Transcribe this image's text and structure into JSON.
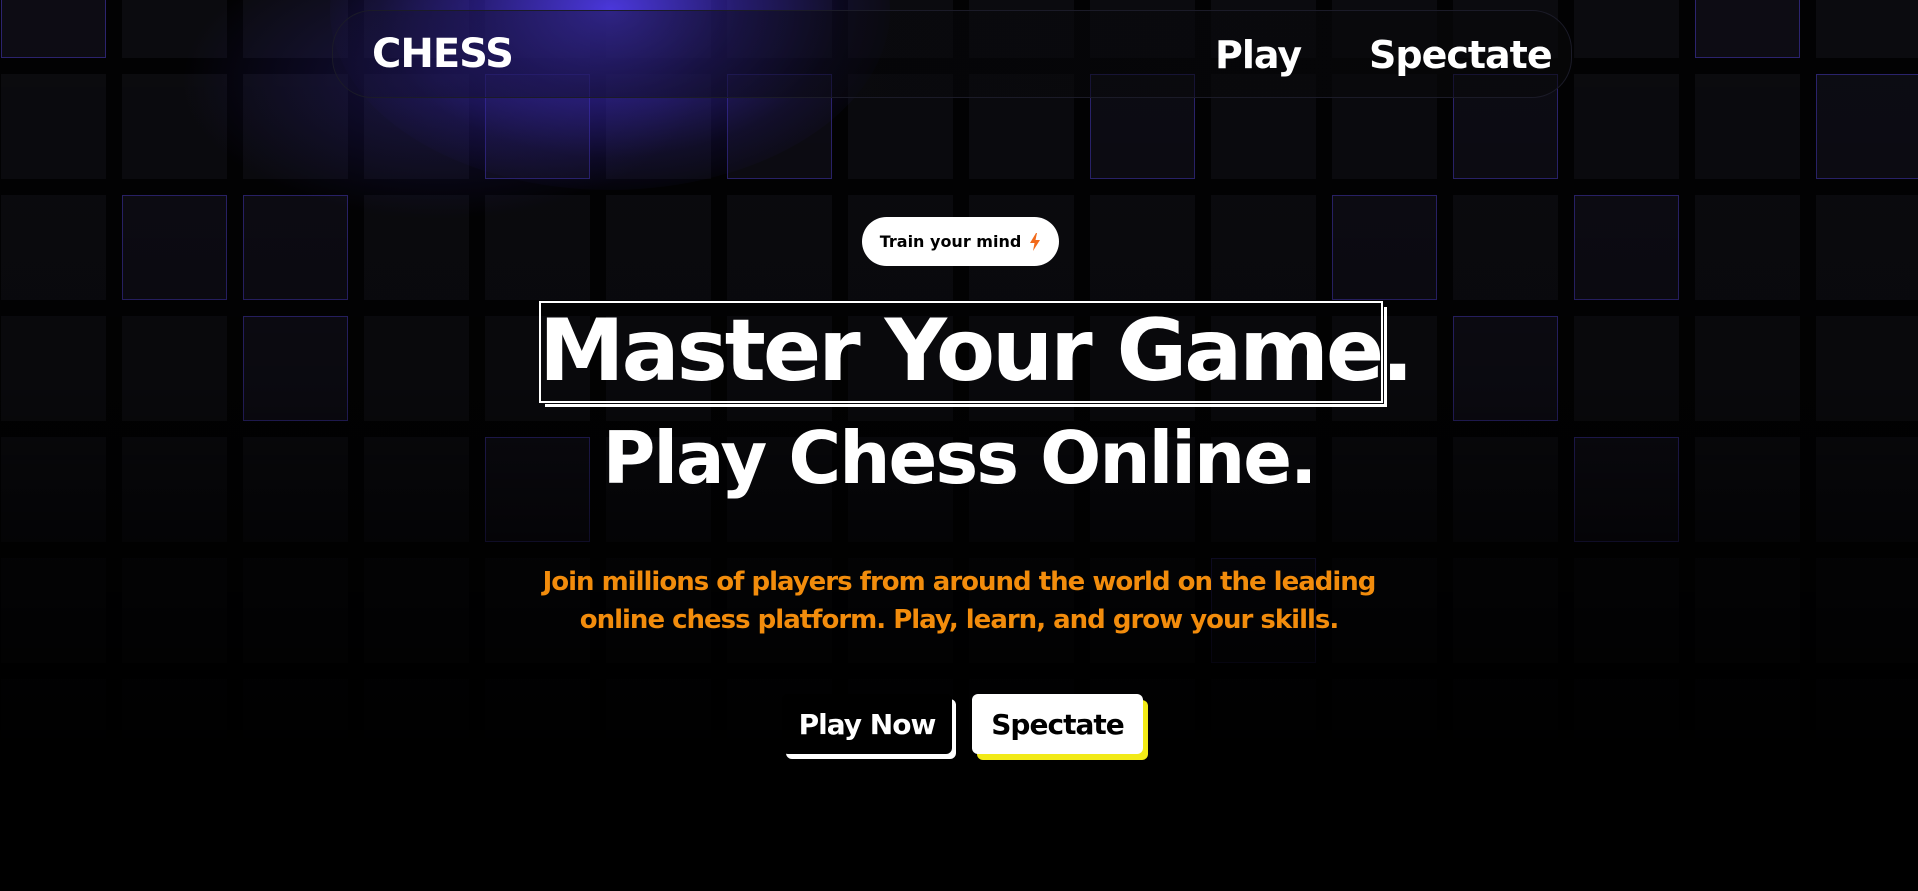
{
  "nav": {
    "logo": "CHESS",
    "links": [
      "Play",
      "Spectate"
    ]
  },
  "hero": {
    "badge": "Train your mind",
    "badge_icon": "lightning-bolt-icon",
    "title_line1": "Master Your Game.",
    "title_line2": "Play Chess Online.",
    "subtitle": "Join millions of players from around the world on the leading online chess platform. Play, learn, and grow your skills.",
    "buttons": {
      "primary": "Play Now",
      "secondary": "Spectate"
    }
  },
  "colors": {
    "background": "#000000",
    "accent_purple": "#4a3ae6",
    "subtitle_orange": "#f28c0c",
    "spectate_shadow_yellow": "#f2ea17",
    "bolt_orange": "#f26a1b"
  }
}
